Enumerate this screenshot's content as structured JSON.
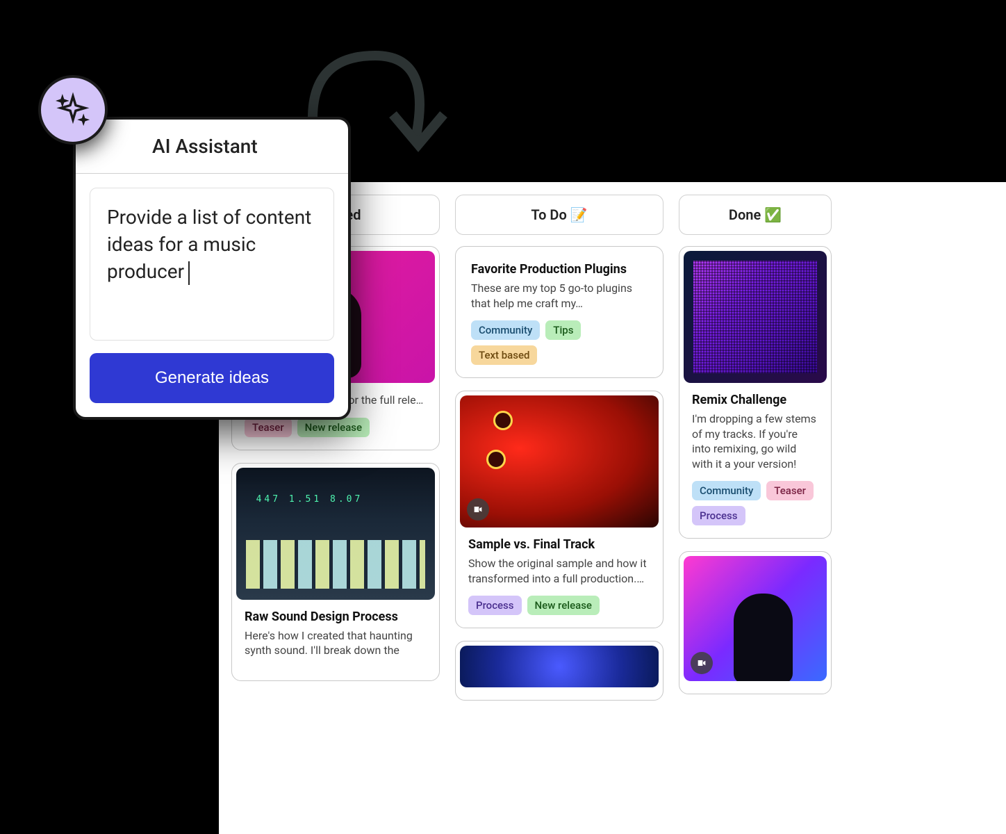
{
  "ai_assistant": {
    "title": "AI Assistant",
    "prompt": "Provide a list of content ideas for a music producer",
    "button": "Generate ideas"
  },
  "columns": [
    {
      "header": "Planned",
      "cards": [
        {
          "image": "magenta",
          "title": "",
          "desc": "…upcoming music …for the full rele…",
          "tags": [
            {
              "label": "Teaser",
              "class": "tag-teaser"
            },
            {
              "label": "New release",
              "class": "tag-newrelease"
            }
          ]
        },
        {
          "image": "pads",
          "title": "Raw Sound Design Process",
          "desc": "Here's how I created that haunting synth sound. I'll break down the",
          "tags": []
        }
      ]
    },
    {
      "header": "To Do 📝",
      "cards": [
        {
          "image": null,
          "title": "Favorite Production Plugins",
          "desc": "These are my top 5 go-to plugins that help me craft my…",
          "tags": [
            {
              "label": "Community",
              "class": "tag-community"
            },
            {
              "label": "Tips",
              "class": "tag-tips"
            },
            {
              "label": "Text based",
              "class": "tag-textbased"
            }
          ]
        },
        {
          "image": "red",
          "video": true,
          "title": "Sample vs. Final Track",
          "desc": "Show the original sample and how it transformed into a full production.…",
          "tags": [
            {
              "label": "Process",
              "class": "tag-process"
            },
            {
              "label": "New release",
              "class": "tag-newrelease"
            }
          ]
        },
        {
          "image": "blue-bokeh",
          "title": "",
          "desc": "",
          "tags": []
        }
      ]
    },
    {
      "header": "Done ✅",
      "cards": [
        {
          "image": "purple-grid",
          "title": "Remix Challenge",
          "desc": "I'm dropping a few stems of my tracks. If you're into remixing, go wild with it a your version!",
          "tags": [
            {
              "label": "Community",
              "class": "tag-community"
            },
            {
              "label": "Teaser",
              "class": "tag-teaser"
            },
            {
              "label": "Process",
              "class": "tag-process"
            }
          ]
        },
        {
          "image": "dj",
          "video": true,
          "title": "",
          "desc": "",
          "tags": []
        }
      ]
    }
  ]
}
